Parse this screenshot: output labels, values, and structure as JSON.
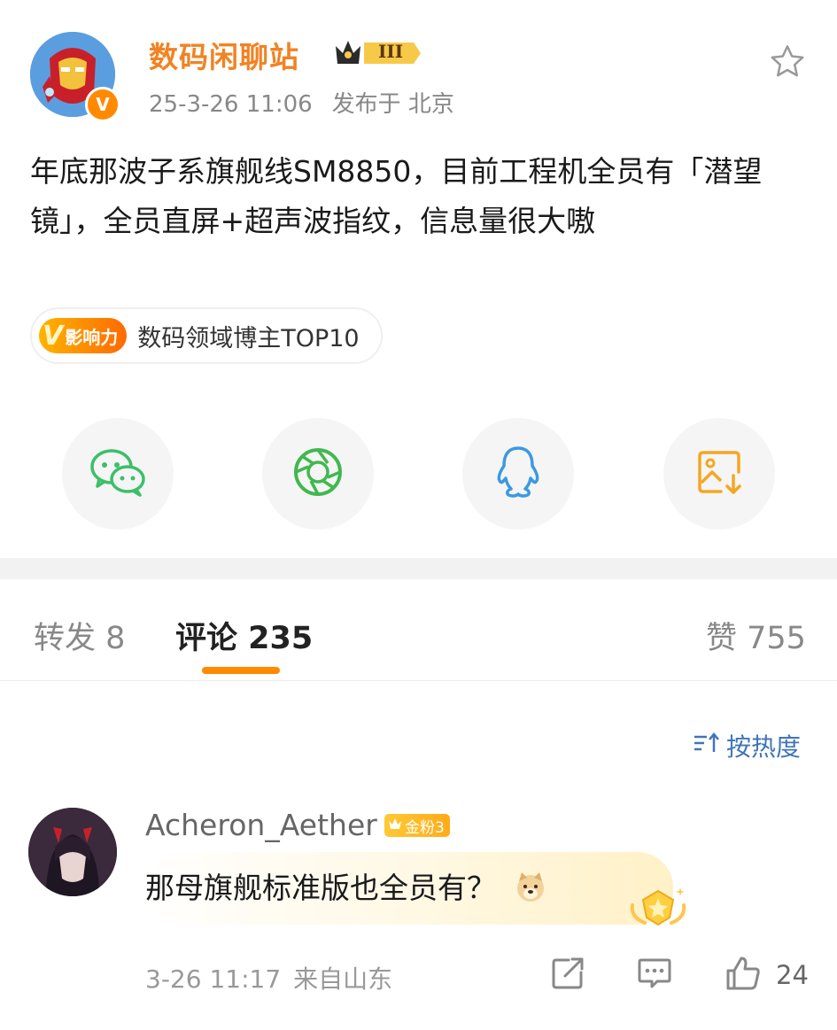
{
  "post": {
    "author": "数码闲聊站",
    "level_badge": "III",
    "verified_mark": "V",
    "time": "25-3-26 11:06",
    "location": "发布于 北京",
    "text": "年底那波子系旗舰线SM8850，目前工程机全员有「潜望镜」，全员直屏+超声波指纹，信息量很大嗷",
    "influence_badge_v": "V",
    "influence_badge_label": "影响力",
    "influence_text": "数码领域博主TOP10"
  },
  "share_buttons": [
    {
      "icon": "wechat-icon"
    },
    {
      "icon": "moments-icon"
    },
    {
      "icon": "qq-icon"
    },
    {
      "icon": "save-image-icon"
    }
  ],
  "tabs": {
    "repost": "转发 8",
    "comments": "评论 235",
    "likes": "赞 755"
  },
  "sort_label": "按热度",
  "comment": {
    "user": "Acheron_Aether",
    "fan_badge": "金粉3",
    "text": "那母旗舰标准版也全员有？",
    "time": "3-26 11:17",
    "from": "来自山东",
    "like_count": "24"
  },
  "colors": {
    "accent": "#ff8a00",
    "username": "#f08323",
    "link": "#3f75b8",
    "wechat": "#3cbf6a",
    "moments": "#41b84f",
    "qq": "#3b9ae0",
    "save": "#f5a623"
  }
}
